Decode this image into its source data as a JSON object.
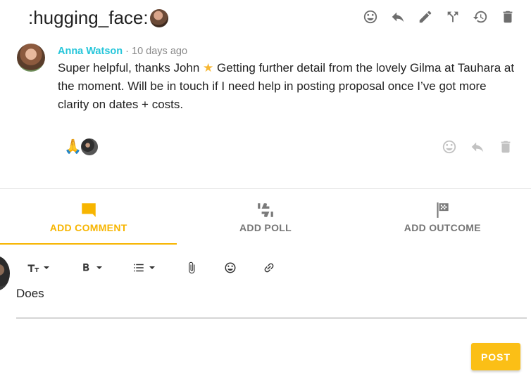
{
  "header": {
    "title": ":hugging_face:",
    "actions": [
      "smiley-icon",
      "reply-icon",
      "edit-icon",
      "fork-icon",
      "history-icon",
      "delete-icon"
    ]
  },
  "comment": {
    "author": "Anna Watson",
    "separator": "·",
    "time": "10 days ago",
    "text_before_star": "Super helpful, thanks John ",
    "star": "★",
    "text_after_star": " Getting further detail from the lovely Gilma at Tauhara at the moment. Will be in touch if I need help in posting proposal once I’ve got more clarity on dates + costs.",
    "reaction_emoji": "🙏",
    "actions": [
      "smiley-icon",
      "reply-icon",
      "delete-icon"
    ]
  },
  "tabs": [
    {
      "label": "ADD COMMENT",
      "icon": "comment-icon",
      "active": true
    },
    {
      "label": "ADD POLL",
      "icon": "thumbs-icon",
      "active": false
    },
    {
      "label": "ADD OUTCOME",
      "icon": "flag-icon",
      "active": false
    }
  ],
  "composer": {
    "toolbar": [
      "text-size-icon",
      "bold-icon",
      "list-icon",
      "attach-icon",
      "emoji-icon",
      "link-icon"
    ],
    "value": "Does",
    "post_label": "POST"
  },
  "colors": {
    "accent": "#f7b500",
    "author": "#26c6da",
    "post_button": "#fbbf16"
  }
}
